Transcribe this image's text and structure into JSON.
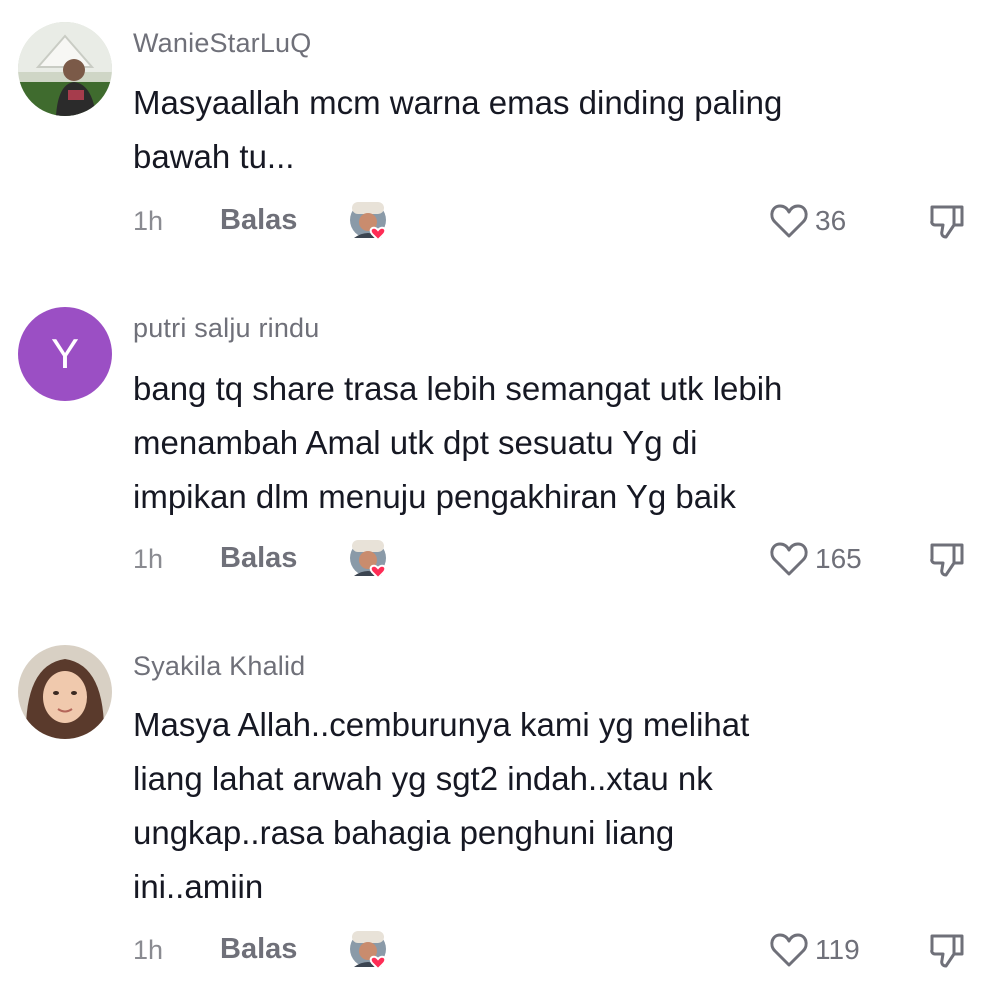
{
  "comments": [
    {
      "username": "WanieStarLuQ",
      "avatar": {
        "type": "photo",
        "icon": "user-photo-avatar"
      },
      "lines": [
        "Masyaallah mcm warna emas dinding paling",
        "bawah tu..."
      ],
      "time": "1h",
      "reply_label": "Balas",
      "likes": "36"
    },
    {
      "username": "putri salju rindu",
      "avatar": {
        "type": "letter",
        "letter": "Y",
        "color": "#9b4fc4"
      },
      "lines": [
        "bang tq share trasa lebih semangat utk lebih",
        "menambah Amal utk dpt sesuatu Yg di",
        "impikan dlm menuju pengakhiran Yg baik"
      ],
      "time": "1h",
      "reply_label": "Balas",
      "likes": "165"
    },
    {
      "username": "Syakila Khalid",
      "avatar": {
        "type": "photo",
        "icon": "user-photo-avatar"
      },
      "lines": [
        "Masya Allah..cemburunya kami yg melihat",
        "liang lahat arwah yg sgt2 indah..xtau nk",
        "ungkap..rasa bahagia penghuni liang",
        "ini..amiin"
      ],
      "time": "1h",
      "reply_label": "Balas",
      "likes": "119"
    }
  ],
  "icons": {
    "like": "heart-outline-icon",
    "dislike": "thumbs-down-icon",
    "creator_liked": "creator-liked-badge-icon"
  },
  "colors": {
    "text": "#161823",
    "secondary": "#6f7079",
    "heart_badge": "#fe2c55",
    "letter_avatar": "#9b4fc4"
  }
}
